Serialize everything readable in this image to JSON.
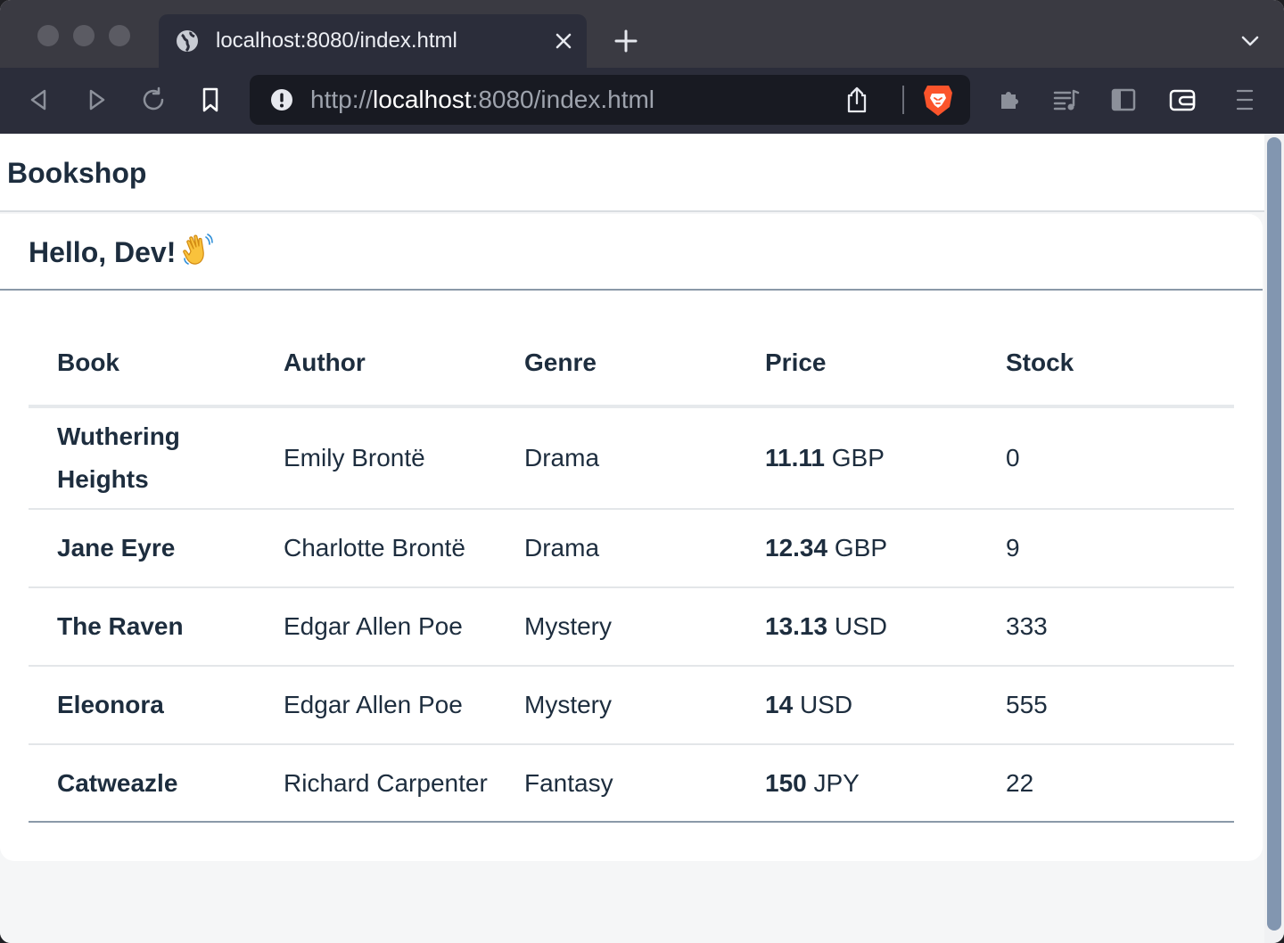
{
  "browser": {
    "tab_title": "localhost:8080/index.html",
    "url_scheme": "http://",
    "url_host": "localhost",
    "url_rest": ":8080/index.html",
    "colors": {
      "chrome": "#2b2d3a",
      "tabstrip": "#3a3a42",
      "urlbar": "#181a22",
      "brave": "#fb542b"
    }
  },
  "app": {
    "title": "Bookshop",
    "greeting": "Hello, Dev!",
    "greeting_emoji": "waving-hand-icon"
  },
  "table": {
    "columns": [
      "Book",
      "Author",
      "Genre",
      "Price",
      "Stock"
    ],
    "rows": [
      {
        "book": "Wuthering Heights",
        "author": "Emily Brontë",
        "genre": "Drama",
        "price": "11.11",
        "currency": "GBP",
        "stock": "0"
      },
      {
        "book": "Jane Eyre",
        "author": "Charlotte Brontë",
        "genre": "Drama",
        "price": "12.34",
        "currency": "GBP",
        "stock": "9"
      },
      {
        "book": "The Raven",
        "author": "Edgar Allen Poe",
        "genre": "Mystery",
        "price": "13.13",
        "currency": "USD",
        "stock": "333"
      },
      {
        "book": "Eleonora",
        "author": "Edgar Allen Poe",
        "genre": "Mystery",
        "price": "14",
        "currency": "USD",
        "stock": "555"
      },
      {
        "book": "Catweazle",
        "author": "Richard Carpenter",
        "genre": "Fantasy",
        "price": "150",
        "currency": "JPY",
        "stock": "22"
      }
    ]
  }
}
